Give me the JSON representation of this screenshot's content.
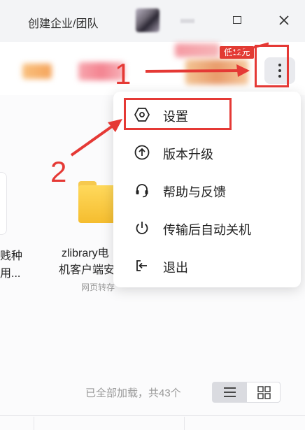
{
  "window": {
    "title": "创建企业/团队"
  },
  "toolbar": {
    "promo_text": "低12元"
  },
  "menu": {
    "items": [
      {
        "label": "设置",
        "icon": "settings-hexagon-icon"
      },
      {
        "label": "版本升级",
        "icon": "upgrade-arrow-icon"
      },
      {
        "label": "帮助与反馈",
        "icon": "headset-icon"
      },
      {
        "label": "传输后自动关机",
        "icon": "power-icon"
      },
      {
        "label": "退出",
        "icon": "logout-icon"
      }
    ]
  },
  "content": {
    "left_stub_line1": "贱种",
    "left_stub_line2": "用...",
    "folder_name_line1": "zlibrary电",
    "folder_name_line2": "机客户端安",
    "folder_sub": "网页转存",
    "status_text": "已全部加载，共43个"
  },
  "annotations": {
    "step1": "1",
    "step2": "2"
  },
  "colors": {
    "highlight_red": "#e53935",
    "folder_yellow": "#f5bd2f",
    "promo_red": "#e23b33"
  }
}
